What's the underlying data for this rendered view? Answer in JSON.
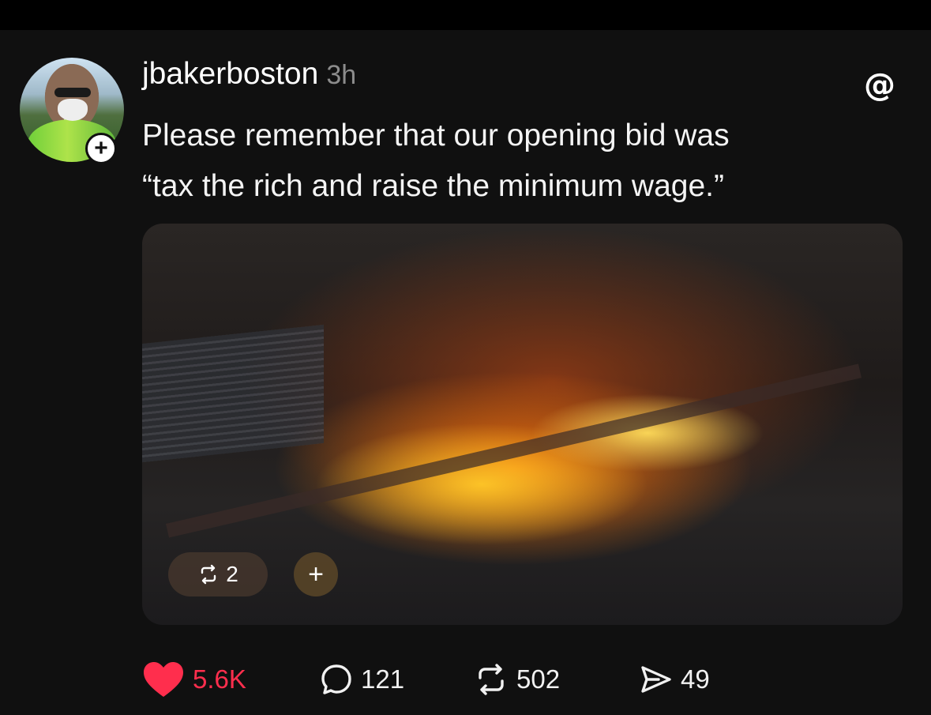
{
  "post": {
    "username": "jbakerboston",
    "time": "3h",
    "text": "Please remember that our opening bid was\n“tax the rich and raise the minimum wage.”",
    "follow_symbol": "+"
  },
  "media": {
    "repost_count": "2",
    "add_symbol": "+"
  },
  "actions": {
    "likes": "5.6K",
    "replies": "121",
    "reposts": "502",
    "shares": "49"
  },
  "icons": {
    "like": "heart-icon",
    "reply": "comment-bubble-icon",
    "repost": "repost-icon",
    "share": "send-icon",
    "brand": "threads-logo-icon"
  },
  "colors": {
    "background": "#101010",
    "like": "#ff2e4d",
    "muted": "#8c8c8c"
  }
}
